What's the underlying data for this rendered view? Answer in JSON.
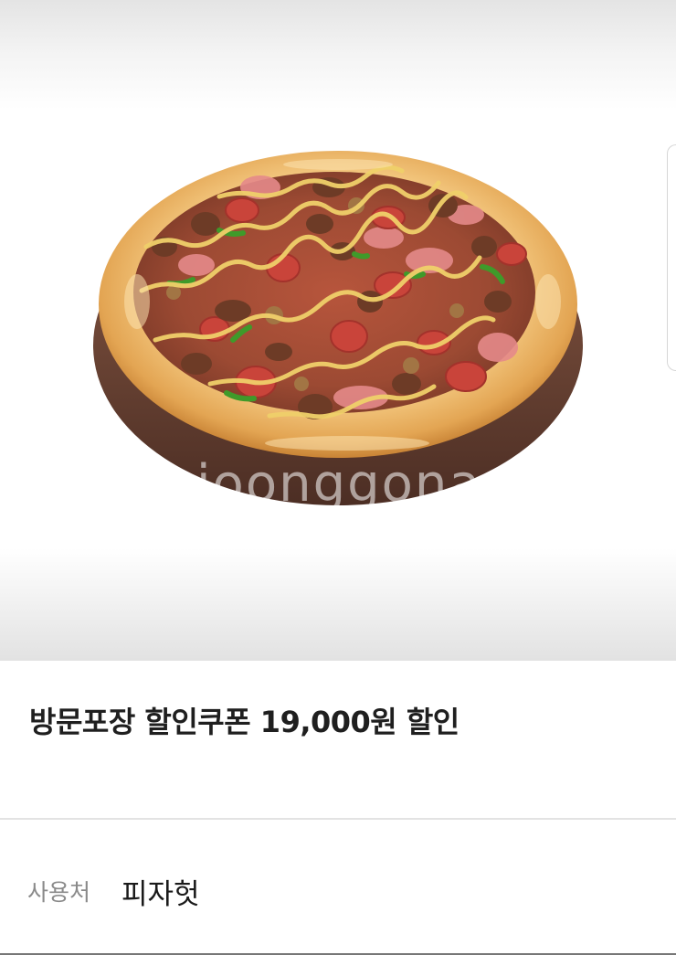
{
  "product_image": {
    "alt": "pizza",
    "watermark": "joonggonara"
  },
  "coupon": {
    "title": "방문포장 할인쿠폰 19,000원 할인"
  },
  "usage": {
    "label": "사용처",
    "value": "피자헛"
  },
  "colors": {
    "title_text": "#1f1f1f",
    "label_text": "#8a8a8a",
    "crust": "#e3a553",
    "board": "#6b4436",
    "sauce_drizzle": "#f0d06a"
  }
}
